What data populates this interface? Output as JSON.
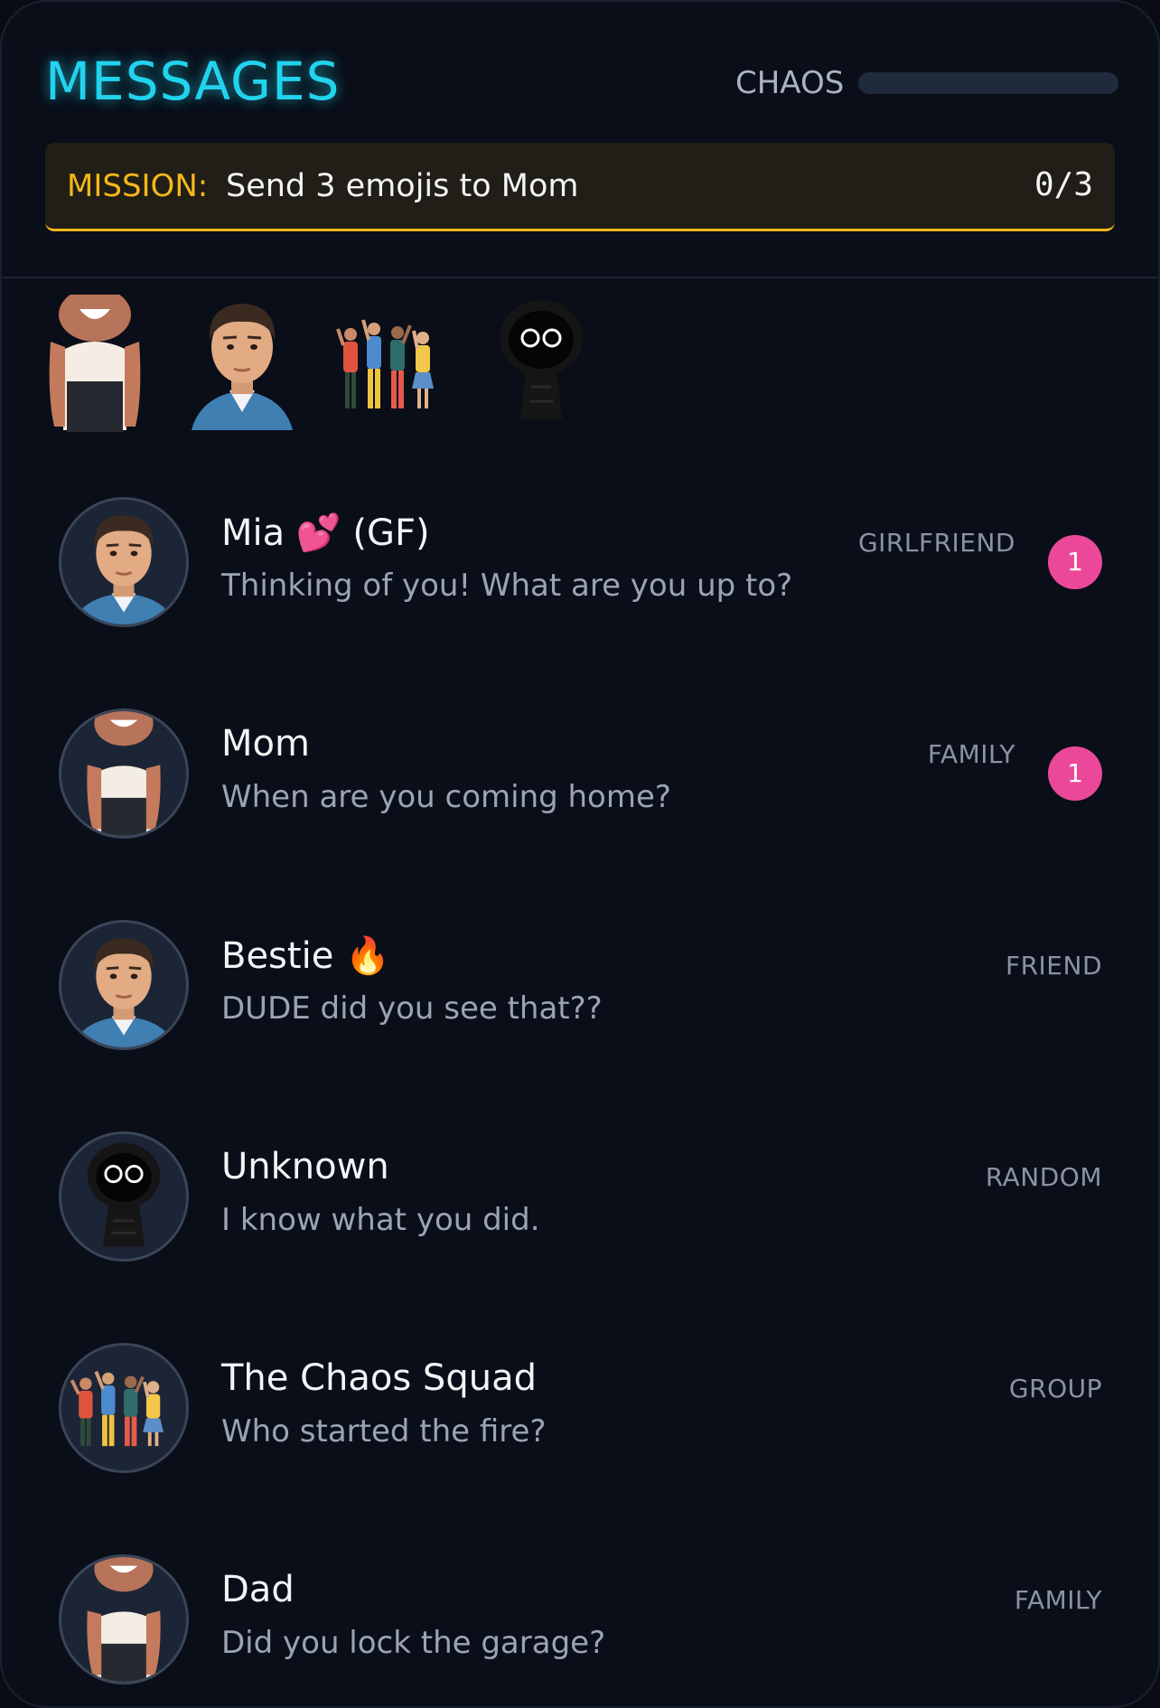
{
  "header": {
    "title": "MESSAGES",
    "chaos_label": "CHAOS",
    "chaos_level": 0
  },
  "mission": {
    "label": "MISSION:",
    "text": "Send 3 emojis to Mom",
    "count": "0/3"
  },
  "stories": [
    {
      "avatar": "mom-icon"
    },
    {
      "avatar": "man-icon"
    },
    {
      "avatar": "group-icon"
    },
    {
      "avatar": "hooded-stranger-icon"
    }
  ],
  "conversations": [
    {
      "name": "Mia 💕 (GF)",
      "preview": "Thinking of you! What are you up to?",
      "tag": "GIRLFRIEND",
      "unread": "1",
      "avatar": "man-icon"
    },
    {
      "name": "Mom",
      "preview": "When are you coming home?",
      "tag": "FAMILY",
      "unread": "1",
      "avatar": "mom-icon"
    },
    {
      "name": "Bestie 🔥",
      "preview": "DUDE did you see that??",
      "tag": "FRIEND",
      "unread": null,
      "avatar": "man-icon"
    },
    {
      "name": "Unknown",
      "preview": "I know what you did.",
      "tag": "RANDOM",
      "unread": null,
      "avatar": "hooded-stranger-icon"
    },
    {
      "name": "The Chaos Squad",
      "preview": "Who started the fire?",
      "tag": "GROUP",
      "unread": null,
      "avatar": "group-icon"
    },
    {
      "name": "Dad",
      "preview": "Did you lock the garage?",
      "tag": "FAMILY",
      "unread": null,
      "avatar": "mom-icon"
    }
  ],
  "colors": {
    "accent": "#22d3ee",
    "mission": "#f5b719",
    "badge": "#ec4899",
    "background": "#0a0e18"
  }
}
